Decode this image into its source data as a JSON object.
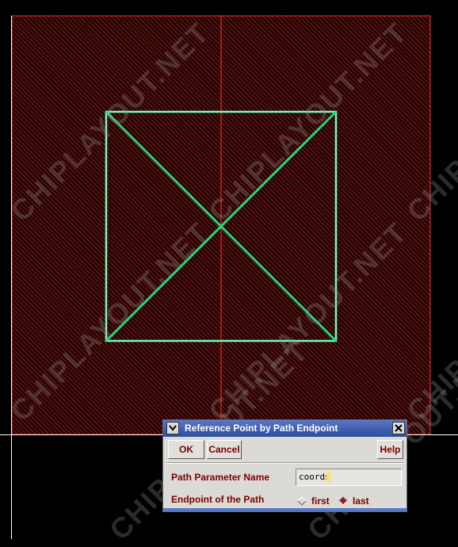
{
  "watermark": {
    "text": "CHIPLAYOUT.NET"
  },
  "colors": {
    "background": "#000000",
    "layer_hatch": "#b02020",
    "layer_outline": "#ff3030",
    "via_shape": "#22d67a",
    "via_box": "#6dffc0",
    "crosshair": "#ffffff"
  },
  "dialog": {
    "title": "Reference Point by Path Endpoint",
    "menu_icon": "chevron-down-icon",
    "close_icon": "close-icon",
    "buttons": {
      "ok": "OK",
      "cancel": "Cancel",
      "help": "Help"
    },
    "path_param": {
      "label": "Path Parameter Name",
      "value": "coords"
    },
    "endpoint": {
      "label": "Endpoint of the Path",
      "options": [
        "first",
        "last"
      ],
      "selected": "last"
    }
  }
}
